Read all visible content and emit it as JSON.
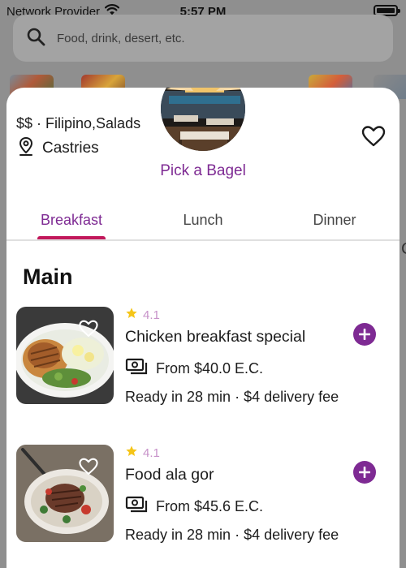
{
  "status_bar": {
    "carrier": "Network Provider",
    "time": "5:57 PM"
  },
  "search": {
    "placeholder": "Food, drink, desert, etc."
  },
  "restaurant": {
    "meta": "$$ · Filipino,Salads",
    "location": "Castries",
    "name": "Pick a Bagel"
  },
  "tabs": [
    {
      "label": "Breakfast",
      "active": true
    },
    {
      "label": "Lunch",
      "active": false
    },
    {
      "label": "Dinner",
      "active": false
    }
  ],
  "section": {
    "title": "Main"
  },
  "menu_items": [
    {
      "rating": "4.1",
      "name": "Chicken breakfast special",
      "price": "From $40.0 E.C.",
      "delivery": "Ready in 28 min · $4 delivery fee"
    },
    {
      "rating": "4.1",
      "name": "Food ala gor",
      "price": "From $45.6 E.C.",
      "delivery": "Ready in 28 min · $4 delivery fee"
    }
  ],
  "icons": {
    "wifi": "wifi-icon",
    "battery": "battery-icon",
    "search": "search-icon",
    "location": "location-pin-icon",
    "favorite": "heart-outline-icon",
    "star": "star-icon",
    "money": "cash-icon",
    "add": "plus-circle-icon"
  },
  "colors": {
    "accent": "#7e2a93",
    "tab_indicator": "#c2185b",
    "rating_star": "#f5c518",
    "rating_text": "#c792c9"
  }
}
